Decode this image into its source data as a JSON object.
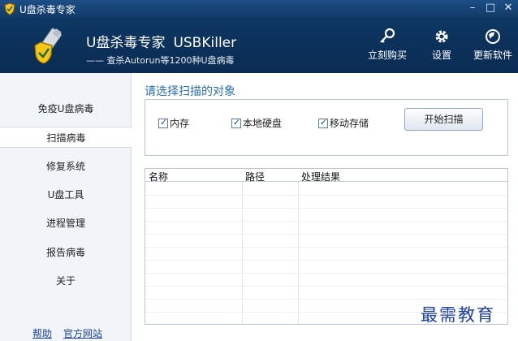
{
  "window": {
    "title": "U盘杀毒专家"
  },
  "header": {
    "brand_cn": "U盘杀毒专家",
    "brand_en": "USBKiller",
    "slogan": "—— 查杀Autorun等1200种U盘病毒"
  },
  "toolbar": {
    "buy_label": "立刻购买",
    "settings_label": "设置",
    "update_label": "更新软件"
  },
  "sidebar": {
    "items": [
      {
        "label": "免疫U盘病毒"
      },
      {
        "label": "扫描病毒"
      },
      {
        "label": "修复系统"
      },
      {
        "label": "U盘工具"
      },
      {
        "label": "进程管理"
      },
      {
        "label": "报告病毒"
      },
      {
        "label": "关于"
      }
    ],
    "active_index": 1,
    "help_link": "帮助",
    "site_link": "官方网站"
  },
  "main": {
    "section_title": "请选择扫描的对象",
    "options": [
      {
        "label": "内存",
        "checked": true
      },
      {
        "label": "本地硬盘",
        "checked": true
      },
      {
        "label": "移动存储",
        "checked": true
      }
    ],
    "scan_button": "开始扫描",
    "table": {
      "columns": [
        "名称",
        "路径",
        "处理结果"
      ],
      "rows": []
    }
  },
  "watermark": "最需教育",
  "colors": {
    "header_bg": "#0a2c52",
    "accent": "#2a6fb3",
    "link": "#1a3fb0"
  }
}
